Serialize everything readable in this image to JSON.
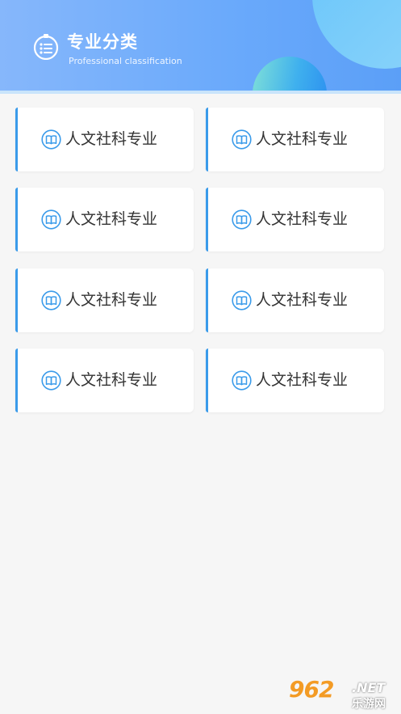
{
  "header": {
    "title": "专业分类",
    "subtitle": "Professional classification",
    "icon": "list-icon"
  },
  "categories": [
    {
      "label": "人文社科专业",
      "icon": "book-icon"
    },
    {
      "label": "人文社科专业",
      "icon": "book-icon"
    },
    {
      "label": "人文社科专业",
      "icon": "book-icon"
    },
    {
      "label": "人文社科专业",
      "icon": "book-icon"
    },
    {
      "label": "人文社科专业",
      "icon": "book-icon"
    },
    {
      "label": "人文社科专业",
      "icon": "book-icon"
    },
    {
      "label": "人文社科专业",
      "icon": "book-icon"
    },
    {
      "label": "人文社科专业",
      "icon": "book-icon"
    }
  ],
  "watermark": {
    "number": "962",
    "suffix": ".NET",
    "site": "乐游网"
  },
  "colors": {
    "accent": "#3a9bea",
    "header": "#6aa9fb",
    "text": "#333333"
  }
}
